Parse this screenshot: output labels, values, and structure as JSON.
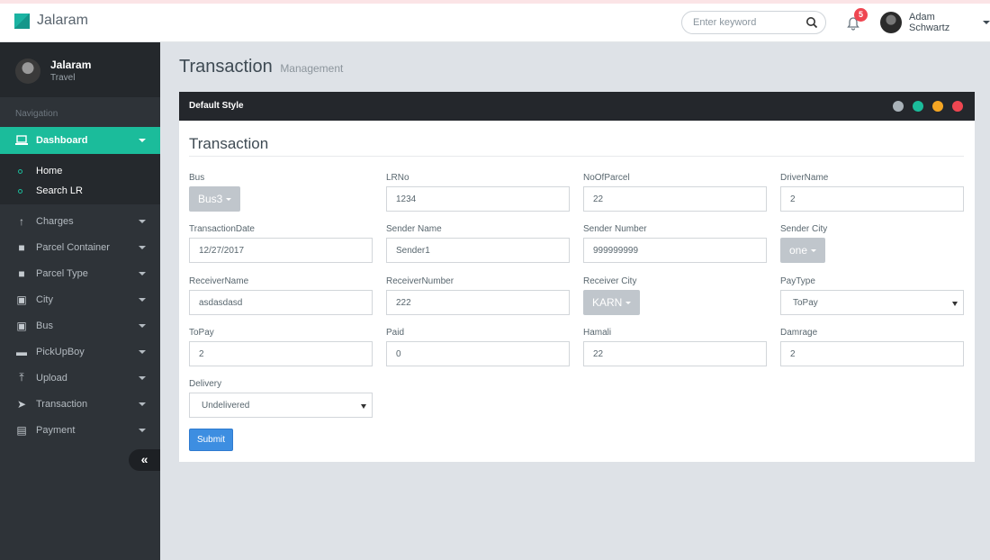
{
  "app": {
    "brand": "Jalaram"
  },
  "topbar": {
    "search_placeholder": "Enter keyword",
    "notification_count": "5",
    "user_name": "Adam Schwartz"
  },
  "sidebar": {
    "profile_name": "Jalaram",
    "profile_sub": "Travel",
    "section_label": "Navigation",
    "active_item": "Dashboard",
    "sub_items": [
      "Home",
      "Search LR"
    ],
    "items": [
      "Charges",
      "Parcel Container",
      "Parcel Type",
      "City",
      "Bus",
      "PickUpBoy",
      "Upload",
      "Transaction",
      "Payment"
    ],
    "collapse_glyph": "«"
  },
  "page": {
    "title": "Transaction",
    "subtitle": "Management"
  },
  "panel": {
    "title": "Default Style",
    "form_title": "Transaction",
    "submit_label": "Submit"
  },
  "form": {
    "bus": {
      "label": "Bus",
      "value": "Bus3"
    },
    "lrno": {
      "label": "LRNo",
      "value": "1234"
    },
    "noofparcel": {
      "label": "NoOfParcel",
      "value": "22"
    },
    "drivername": {
      "label": "DriverName",
      "value": "2"
    },
    "transactiondate": {
      "label": "TransactionDate",
      "value": "12/27/2017"
    },
    "sendername": {
      "label": "Sender Name",
      "value": "Sender1"
    },
    "sendernumber": {
      "label": "Sender Number",
      "value": "999999999"
    },
    "sendercity": {
      "label": "Sender City",
      "value": "one"
    },
    "receivername": {
      "label": "ReceiverName",
      "value": "asdasdasd"
    },
    "receivernumber": {
      "label": "ReceiverNumber",
      "value": "222"
    },
    "receivercity": {
      "label": "Receiver City",
      "value": "KARN"
    },
    "paytype": {
      "label": "PayType",
      "value": "ToPay"
    },
    "topay": {
      "label": "ToPay",
      "value": "2"
    },
    "paid": {
      "label": "Paid",
      "value": "0"
    },
    "hamali": {
      "label": "Hamali",
      "value": "22"
    },
    "damrage": {
      "label": "Damrage",
      "value": "2"
    },
    "delivery": {
      "label": "Delivery",
      "value": "Undelivered"
    }
  },
  "colors": {
    "accent": "#1bbc9b",
    "submit": "#3d8ee1",
    "badge": "#ef4651",
    "sidebar_bg": "#2e3338"
  },
  "icons": [
    "search-icon",
    "bell-icon",
    "laptop-icon",
    "expand-icon",
    "refresh-icon",
    "minimize-icon",
    "close-icon"
  ]
}
